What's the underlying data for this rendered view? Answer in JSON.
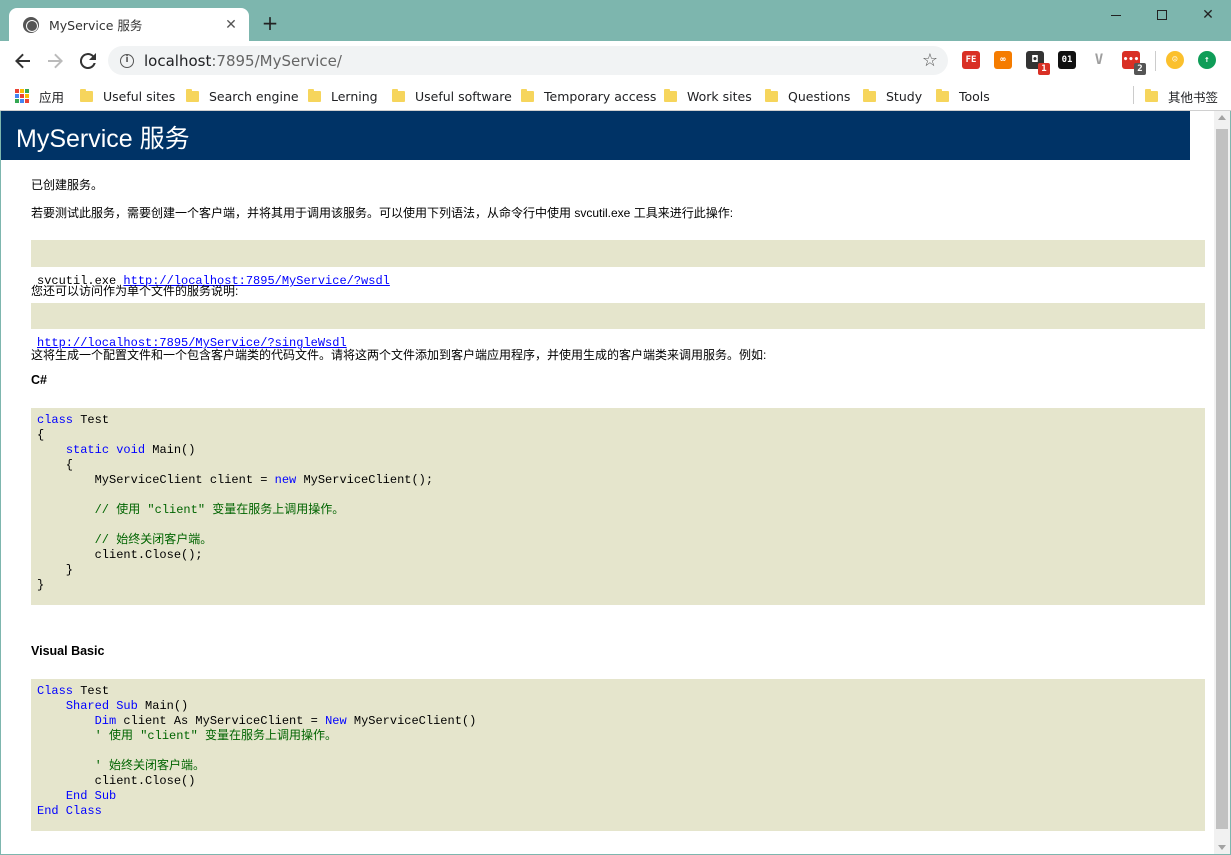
{
  "browser": {
    "tab_title": "MyService 服务",
    "new_tab": "+",
    "url_host": "localhost",
    "url_rest": ":7895/MyService/",
    "extensions": [
      {
        "name": "fe-extension-icon",
        "label": "FE",
        "color": "#d93025"
      },
      {
        "name": "infinity-extension-icon",
        "label": "∞",
        "color": "#f57c00"
      },
      {
        "name": "puzzle-extension-icon",
        "label": "◘",
        "color": "#333333",
        "badge": "1",
        "badge_color": "#d93025"
      },
      {
        "name": "binary-extension-icon",
        "label": "01",
        "color": "#111111"
      },
      {
        "name": "vue-extension-icon",
        "label": "V",
        "color": "#9e9e9e"
      },
      {
        "name": "dots-extension-icon",
        "label": "•••",
        "color": "#d93025",
        "badge": "2",
        "badge_color": "#555555"
      },
      {
        "name": "emoji-extension-icon",
        "label": "☺",
        "color": "#fbc02d"
      },
      {
        "name": "upload-extension-icon",
        "label": "↑",
        "color": "#0f9d58"
      }
    ]
  },
  "bookmarks": {
    "apps": "应用",
    "items": [
      "Useful sites",
      "Search engine",
      "Lerning",
      "Useful software",
      "Temporary access",
      "Work sites",
      "Questions",
      "Study",
      "Tools"
    ],
    "other": "其他书签"
  },
  "page": {
    "heading": "MyService 服务",
    "created": "已创建服务。",
    "intro": "若要测试此服务，需要创建一个客户端，并将其用于调用该服务。可以使用下列语法，从命令行中使用 svcutil.exe 工具来进行此操作:",
    "svcutil_cmd": "svcutil.exe ",
    "wsdl_url": "http://localhost:7895/MyService/?wsdl",
    "single_intro": "您还可以访问作为单个文件的服务说明:",
    "single_url": "http://localhost:7895/MyService/?singleWsdl",
    "generate_text": "这将生成一个配置文件和一个包含客户端类的代码文件。请将这两个文件添加到客户端应用程序，并使用生成的客户端类来调用服务。例如:",
    "csharp_title": "C#",
    "vb_title": "Visual Basic"
  },
  "csharp_code": [
    [
      {
        "t": "class",
        "c": "kw"
      },
      {
        "t": " Test"
      }
    ],
    [
      {
        "t": "{"
      }
    ],
    [
      {
        "t": "    "
      },
      {
        "t": "static",
        "c": "kw"
      },
      {
        "t": " "
      },
      {
        "t": "void",
        "c": "kw"
      },
      {
        "t": " Main()"
      }
    ],
    [
      {
        "t": "    {"
      }
    ],
    [
      {
        "t": "        MyServiceClient client = "
      },
      {
        "t": "new",
        "c": "kw"
      },
      {
        "t": " MyServiceClient();"
      }
    ],
    [
      {
        "t": ""
      }
    ],
    [
      {
        "t": "        // 使用 \"client\" 变量在服务上调用操作。",
        "c": "cm"
      }
    ],
    [
      {
        "t": ""
      }
    ],
    [
      {
        "t": "        // 始终关闭客户端。",
        "c": "cm"
      }
    ],
    [
      {
        "t": "        client.Close();"
      }
    ],
    [
      {
        "t": "    }"
      }
    ],
    [
      {
        "t": "}"
      }
    ]
  ],
  "vb_code": [
    [
      {
        "t": "Class",
        "c": "kw"
      },
      {
        "t": " Test"
      }
    ],
    [
      {
        "t": "    "
      },
      {
        "t": "Shared",
        "c": "kw"
      },
      {
        "t": " "
      },
      {
        "t": "Sub",
        "c": "kw"
      },
      {
        "t": " Main()"
      }
    ],
    [
      {
        "t": "        "
      },
      {
        "t": "Dim",
        "c": "kw"
      },
      {
        "t": " client As MyServiceClient = "
      },
      {
        "t": "New",
        "c": "kw"
      },
      {
        "t": " MyServiceClient()"
      }
    ],
    [
      {
        "t": "        ' 使用 \"client\" 变量在服务上调用操作。",
        "c": "cm"
      }
    ],
    [
      {
        "t": ""
      }
    ],
    [
      {
        "t": "        ' 始终关闭客户端。",
        "c": "cm"
      }
    ],
    [
      {
        "t": "        client.Close()"
      }
    ],
    [
      {
        "t": "    "
      },
      {
        "t": "End Sub",
        "c": "kw"
      }
    ],
    [
      {
        "t": "End Class",
        "c": "kw"
      }
    ]
  ]
}
